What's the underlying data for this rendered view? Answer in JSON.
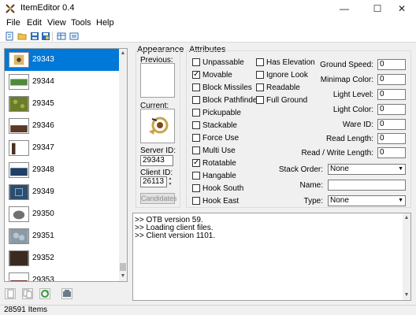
{
  "window": {
    "title": "ItemEditor 0.4",
    "min_glyph": "—",
    "max_glyph": "☐",
    "close_glyph": "✕"
  },
  "menu": [
    "File",
    "Edit",
    "View",
    "Tools",
    "Help"
  ],
  "toolbar": {
    "icons": [
      "new-file-icon",
      "open-folder-icon",
      "save-icon",
      "save-as-icon",
      "compare-icon",
      "find-item-icon"
    ]
  },
  "item_list": {
    "items": [
      {
        "id": "29343",
        "selected": true,
        "thumb_color": "#d8b86a"
      },
      {
        "id": "29344",
        "selected": false,
        "thumb_color": "#4f8a3c"
      },
      {
        "id": "29345",
        "selected": false,
        "thumb_color": "#6b7d2a"
      },
      {
        "id": "29346",
        "selected": false,
        "thumb_color": "#5a3a28"
      },
      {
        "id": "29347",
        "selected": false,
        "thumb_color": "#4a3020"
      },
      {
        "id": "29348",
        "selected": false,
        "thumb_color": "#1f3f66"
      },
      {
        "id": "29349",
        "selected": false,
        "thumb_color": "#2c4d6e"
      },
      {
        "id": "29350",
        "selected": false,
        "thumb_color": "#707070"
      },
      {
        "id": "29351",
        "selected": false,
        "thumb_color": "#8a9aa6"
      },
      {
        "id": "29352",
        "selected": false,
        "thumb_color": "#3a2a20"
      },
      {
        "id": "29353",
        "selected": false,
        "thumb_color": "#6a2a20"
      }
    ],
    "scroll_up": "▲",
    "scroll_down": "▼"
  },
  "bottom_buttons": [
    "item-icon",
    "copy-icon",
    "refresh-icon",
    "find-icon"
  ],
  "status": {
    "items_count": "28591 Items"
  },
  "appearance": {
    "title": "Appearance",
    "previous_label": "Previous:",
    "current_label": "Current:",
    "server_id_label": "Server ID:",
    "server_id_value": "29343",
    "client_id_label": "Client ID:",
    "client_id_value": "26113",
    "candidates_label": "Candidates",
    "spin_up": "▲",
    "spin_down": "▼"
  },
  "attributes": {
    "title": "Attributes",
    "col1": [
      {
        "label": "Unpassable",
        "checked": false
      },
      {
        "label": "Movable",
        "checked": true
      },
      {
        "label": "Block Missiles",
        "checked": false
      },
      {
        "label": "Block Pathfinder",
        "checked": false
      },
      {
        "label": "Pickupable",
        "checked": false
      },
      {
        "label": "Stackable",
        "checked": false
      },
      {
        "label": "Force Use",
        "checked": false
      },
      {
        "label": "Multi Use",
        "checked": false
      },
      {
        "label": "Rotatable",
        "checked": true
      },
      {
        "label": "Hangable",
        "checked": false
      },
      {
        "label": "Hook South",
        "checked": false
      },
      {
        "label": "Hook East",
        "checked": false
      }
    ],
    "col2": [
      {
        "label": "Has Elevation",
        "checked": false
      },
      {
        "label": "Ignore Look",
        "checked": false
      },
      {
        "label": "Readable",
        "checked": false
      },
      {
        "label": "Full Ground",
        "checked": false
      }
    ],
    "fields": [
      {
        "label": "Ground Speed:",
        "value": "0"
      },
      {
        "label": "Minimap Color:",
        "value": "0"
      },
      {
        "label": "Light Level:",
        "value": "0"
      },
      {
        "label": "Light Color:",
        "value": "0"
      },
      {
        "label": "Ware ID:",
        "value": "0"
      },
      {
        "label": "Read Length:",
        "value": "0"
      },
      {
        "label": "Read / Write Length:",
        "value": "0"
      }
    ],
    "stack_order_label": "Stack Order:",
    "stack_order_value": "None",
    "name_label": "Name:",
    "name_value": "",
    "type_label": "Type:",
    "type_value": "None",
    "check_mark": "✓",
    "dropdown_glyph": "▼"
  },
  "output": {
    "lines": [
      ">> OTB version 59.",
      ">> Loading client files.",
      ">> Client version 1101."
    ],
    "scroll_up": "▲",
    "scroll_down": "▼"
  }
}
